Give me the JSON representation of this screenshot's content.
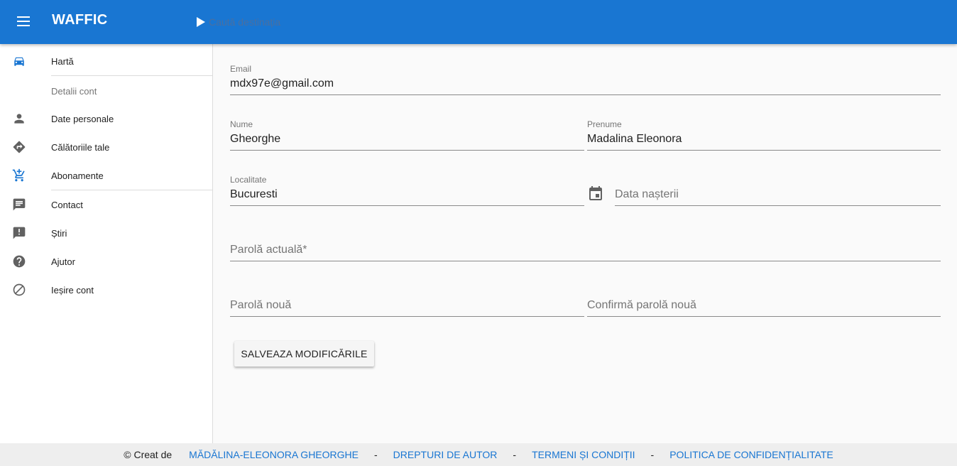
{
  "app": {
    "title": "WAFFIC",
    "search_placeholder": "Caută destinația"
  },
  "sidebar": {
    "items": [
      {
        "label": "Hartă",
        "icon": "car-icon",
        "color": "#1976d2"
      },
      {
        "label": "Date personale",
        "icon": "person-icon"
      },
      {
        "label": "Călătoriile tale",
        "icon": "directions-icon"
      },
      {
        "label": "Abonamente",
        "icon": "add-shopping-cart-icon",
        "color": "#1976d2"
      },
      {
        "label": "Contact",
        "icon": "feedback-icon"
      },
      {
        "label": "Știri",
        "icon": "announcement-icon"
      },
      {
        "label": "Ajutor",
        "icon": "help-icon"
      },
      {
        "label": "Ieșire cont",
        "icon": "block-icon"
      }
    ],
    "section_header": "Detalii cont"
  },
  "form": {
    "email": {
      "label": "Email",
      "value": "mdx97e@gmail.com"
    },
    "nume": {
      "label": "Nume",
      "value": "Gheorghe"
    },
    "prenume": {
      "label": "Prenume",
      "value": "Madalina Eleonora"
    },
    "localitate": {
      "label": "Localitate",
      "value": "Bucuresti"
    },
    "data_nasterii": {
      "placeholder": "Data nașterii"
    },
    "parola_actuala": {
      "placeholder": "Parolă actuală*"
    },
    "parola_noua": {
      "placeholder": "Parolă nouă"
    },
    "confirma_parola": {
      "placeholder": "Confirmă parolă nouă"
    },
    "save_label": "SALVEAZA MODIFICĂRILE"
  },
  "footer": {
    "credit": "© Creat de",
    "author": "MĂDĂLINA-ELEONORA GHEORGHE",
    "separator": "-",
    "links": [
      "DREPTURI DE AUTOR",
      "TERMENI ȘI CONDIȚII",
      "POLITICA DE CONFIDENȚIALITATE"
    ]
  },
  "colors": {
    "primary": "#1976d2",
    "icon_grey": "#616161",
    "footer_bg": "#eeeeee"
  }
}
